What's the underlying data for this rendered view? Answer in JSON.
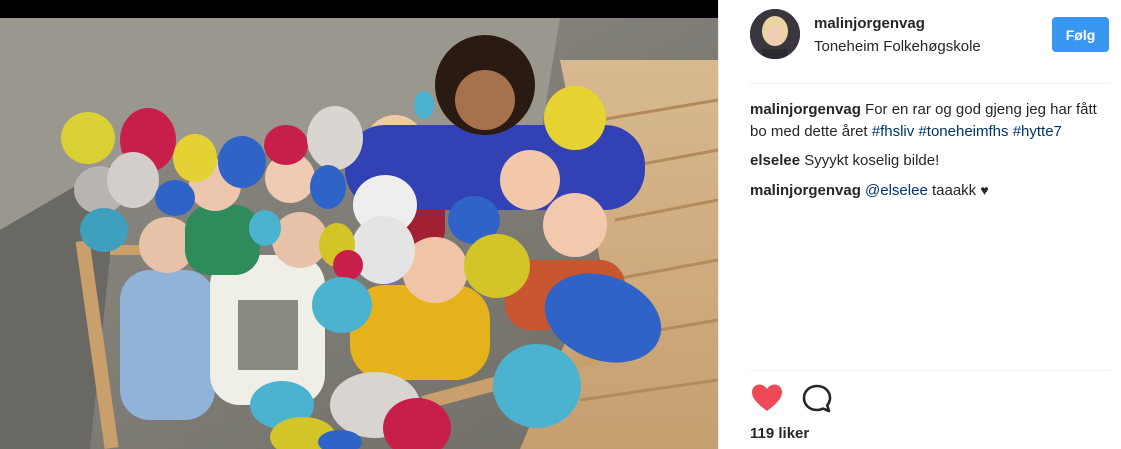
{
  "post": {
    "username": "malinjorgenvag",
    "location": "Toneheim Folkehøgskole",
    "follow_label": "Følg"
  },
  "caption": {
    "user": "malinjorgenvag",
    "text": "For en rar og god gjeng jeg har fått bo med dette året",
    "hashtags": [
      "#fhsliv",
      "#toneheimfhs",
      "#hytte7"
    ]
  },
  "comments": [
    {
      "user": "elselee",
      "text": "Syyykt koselig bilde!"
    },
    {
      "user": "malinjorgenvag",
      "mention": "@elselee",
      "text": "taaakk",
      "emoji": "♥"
    }
  ],
  "likes": {
    "label": "119 liker"
  },
  "icons": {
    "like": "heart-icon",
    "comment": "speech-bubble-icon"
  },
  "colors": {
    "accent": "#3897f0",
    "hashtag": "#003569",
    "like_red": "#ed4956"
  }
}
